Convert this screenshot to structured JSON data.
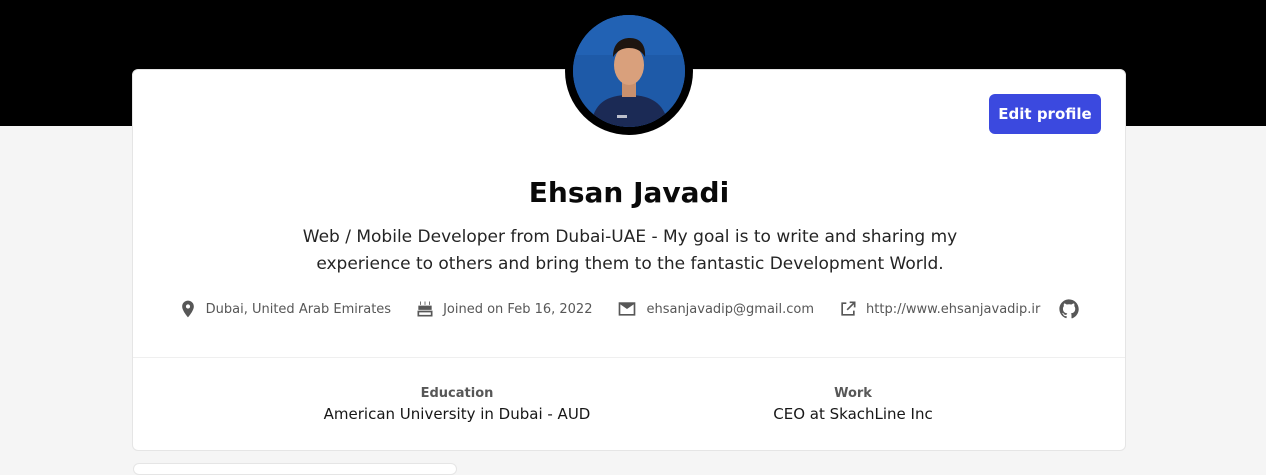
{
  "profile": {
    "name": "Ehsan Javadi",
    "bio": "Web / Mobile Developer from Dubai-UAE - My goal is to write and sharing my experience to others and bring them to the fantastic Development World.",
    "edit_label": "Edit profile",
    "avatar_alt": "Ehsan Javadi"
  },
  "meta": {
    "location": "Dubai, United Arab Emirates",
    "joined": "Joined on Feb 16, 2022",
    "email": "ehsanjavadip@gmail.com",
    "website": "http://www.ehsanjavadip.ir"
  },
  "details": {
    "education_label": "Education",
    "education_value": "American University in Dubai - AUD",
    "work_label": "Work",
    "work_value": "CEO at SkachLine Inc"
  },
  "icons": {
    "location": "location-pin-icon",
    "joined": "cake-icon",
    "email": "mail-icon",
    "website": "external-link-icon",
    "github": "github-icon"
  },
  "colors": {
    "banner": "#000000",
    "accent": "#3b49df",
    "avatar_bg": "#1e5aa8"
  }
}
